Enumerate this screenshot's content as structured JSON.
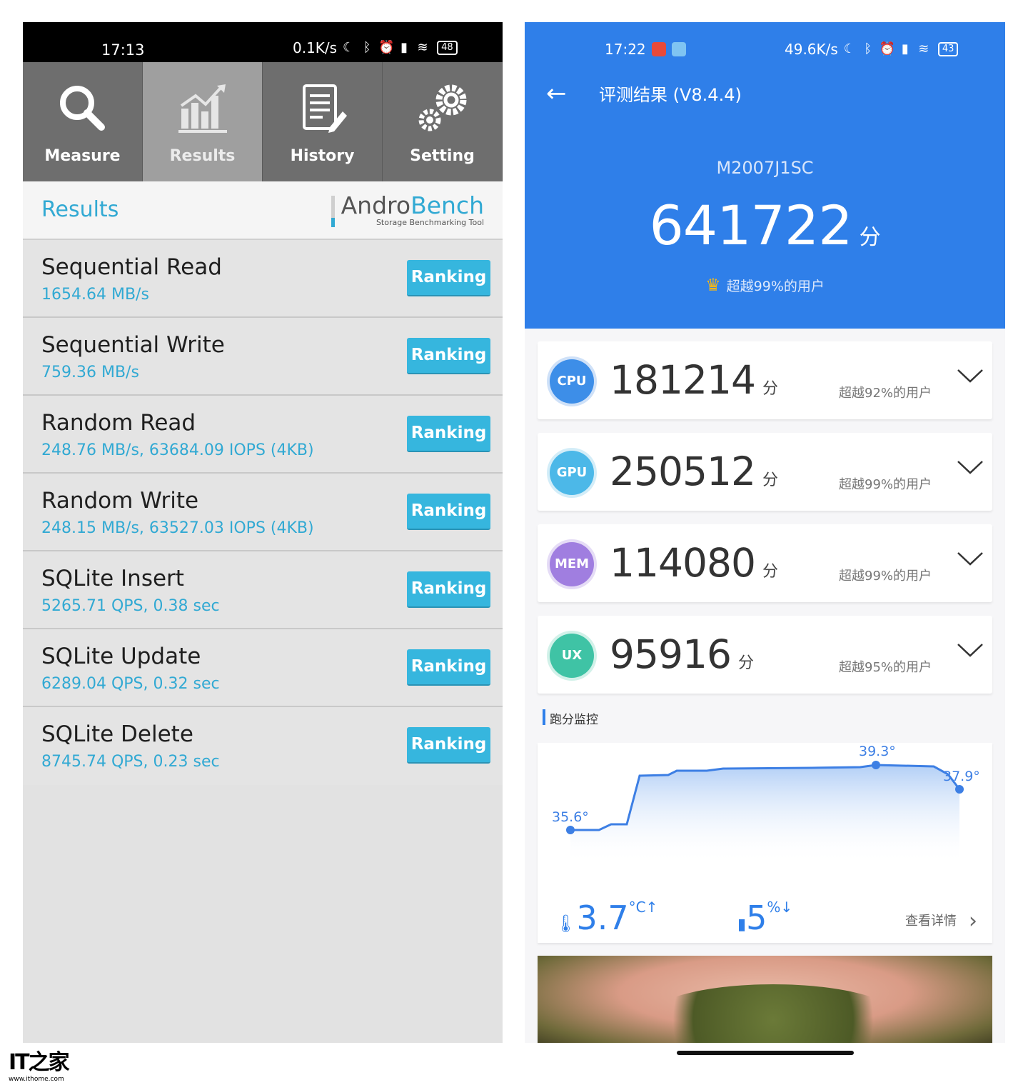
{
  "left_phone": {
    "status_bar": {
      "time": "17:13",
      "net_speed": "0.1K/s",
      "battery": "48"
    },
    "tabs": [
      {
        "label": "Measure",
        "icon": "magnifier-icon",
        "active": false
      },
      {
        "label": "Results",
        "icon": "chart-icon",
        "active": true
      },
      {
        "label": "History",
        "icon": "document-icon",
        "active": false
      },
      {
        "label": "Setting",
        "icon": "gears-icon",
        "active": false
      }
    ],
    "header": {
      "title": "Results",
      "logo_part1": "Andro",
      "logo_part2": "Bench",
      "logo_sub": "Storage Benchmarking Tool"
    },
    "ranking_label": "Ranking",
    "results": [
      {
        "name": "Sequential Read",
        "value": "1654.64 MB/s"
      },
      {
        "name": "Sequential Write",
        "value": "759.36 MB/s"
      },
      {
        "name": "Random Read",
        "value": "248.76 MB/s, 63684.09 IOPS (4KB)"
      },
      {
        "name": "Random Write",
        "value": "248.15 MB/s, 63527.03 IOPS (4KB)"
      },
      {
        "name": "SQLite Insert",
        "value": "5265.71 QPS, 0.38 sec"
      },
      {
        "name": "SQLite Update",
        "value": "6289.04 QPS, 0.32 sec"
      },
      {
        "name": "SQLite Delete",
        "value": "8745.74 QPS, 0.23 sec"
      }
    ]
  },
  "right_phone": {
    "status_bar": {
      "time": "17:22",
      "net_speed": "49.6K/s",
      "battery": "43"
    },
    "title": "评测结果 (V8.4.4)",
    "model": "M2007J1SC",
    "total_score": "641722",
    "score_unit": "分",
    "total_beat": "超越99%的用户",
    "cards": [
      {
        "badge": "CPU",
        "score": "181214",
        "beat": "超越92%的用户",
        "color": "#3d8ee8"
      },
      {
        "badge": "GPU",
        "score": "250512",
        "beat": "超越99%的用户",
        "color": "#4cb8e8"
      },
      {
        "badge": "MEM",
        "score": "114080",
        "beat": "超越99%的用户",
        "color": "#a07ee0"
      },
      {
        "badge": "UX",
        "score": "95916",
        "beat": "超越95%的用户",
        "color": "#3fc3a5"
      }
    ],
    "monitor": {
      "label": "跑分监控",
      "temp_start": "35.6°",
      "temp_peak": "39.3°",
      "temp_end": "37.9°",
      "temp_rise": "3.7",
      "temp_rise_unit": "°C↑",
      "battery_drop": "5",
      "battery_drop_unit": "%↓",
      "details": "查看详情"
    }
  },
  "watermark": {
    "brand": "IT之家",
    "url": "www.ithome.com"
  }
}
